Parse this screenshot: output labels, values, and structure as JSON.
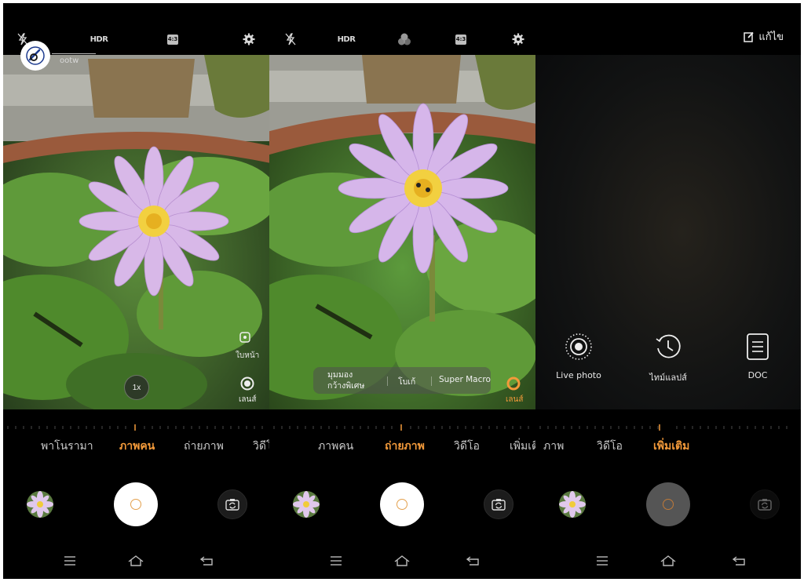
{
  "watermark": {
    "text": "ootw"
  },
  "panels": [
    {
      "id": "portrait",
      "zoom_label": "1x",
      "front_label": "ใบหน้า",
      "lens_label": "เลนส์",
      "modes": [
        {
          "label": "พาโนรามา",
          "active": false
        },
        {
          "label": "ภาพคน",
          "active": true
        },
        {
          "label": "ถ่ายภาพ",
          "active": false
        },
        {
          "label": "วิดีโอ",
          "active": false
        }
      ]
    },
    {
      "id": "photo",
      "lens_options": [
        "มุมมองกว้างพิเศษ",
        "โบเก้",
        "Super Macro"
      ],
      "lens_label": "เลนส์",
      "modes": [
        {
          "label": "ภาพคน",
          "active": false
        },
        {
          "label": "ถ่ายภาพ",
          "active": true
        },
        {
          "label": "วิดีโอ",
          "active": false
        },
        {
          "label": "เพิ่มเติม",
          "active": false
        }
      ]
    },
    {
      "id": "more",
      "edit_label": "แก้ไข",
      "extra_modes": [
        {
          "label": "Live photo",
          "icon": "live-photo-icon"
        },
        {
          "label": "ไทม์แลปส์",
          "icon": "timelapse-icon"
        },
        {
          "label": "DOC",
          "icon": "document-icon"
        }
      ],
      "modes": [
        {
          "label": "ภาพ",
          "active": false
        },
        {
          "label": "วิดีโอ",
          "active": false
        },
        {
          "label": "เพิ่มเติม",
          "active": true
        }
      ]
    }
  ],
  "header_icons": [
    "flash-off-icon",
    "hdr-icon",
    "filter-icon",
    "aspect-ratio-icon",
    "settings-icon"
  ],
  "hdr_text": "HDR",
  "ratio_text": "4:3",
  "colors": {
    "accent": "#f39a3a",
    "background": "#000000"
  }
}
